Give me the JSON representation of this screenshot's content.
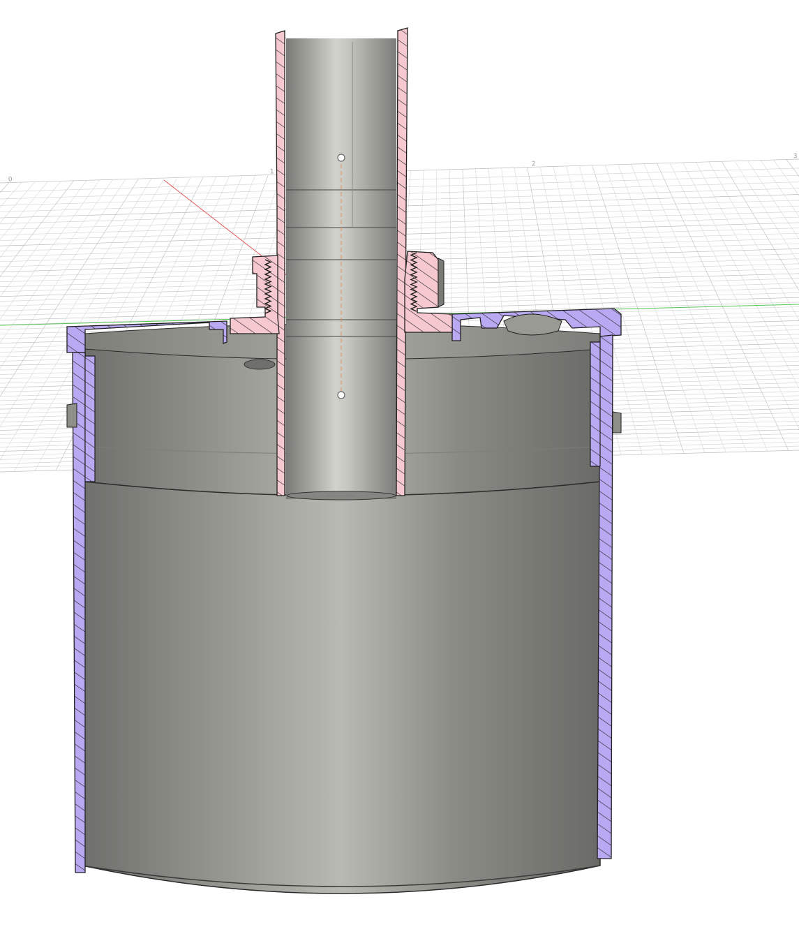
{
  "app": {
    "viewport": "cad-3d-viewport",
    "view_mode": "section-analysis"
  },
  "colors": {
    "background": "#ffffff",
    "grid_line": "#d6d6d6",
    "grid_line_major": "#bdbdbd",
    "axis_x": "#e05858",
    "axis_z": "#55c455",
    "body_metal": "#9a9a94",
    "body_metal_light": "#c6c6c0",
    "body_metal_dark": "#707070",
    "section_housing": "#b9a8f2",
    "section_fitting": "#f6c8cf",
    "hatch": "#2a2a2a",
    "outline": "#1f1f1f",
    "axis_centerline": "#d88a5a"
  },
  "grid": {
    "tick_labels": [
      "0",
      "",
      "1",
      "",
      "2",
      "",
      "3"
    ]
  },
  "components": {
    "housing": {
      "name": "housing-section",
      "color_key": "section_housing"
    },
    "fitting": {
      "name": "fitting-section",
      "color_key": "section_fitting"
    },
    "tube": {
      "name": "tube"
    },
    "cylinder": {
      "name": "canister-body"
    }
  }
}
